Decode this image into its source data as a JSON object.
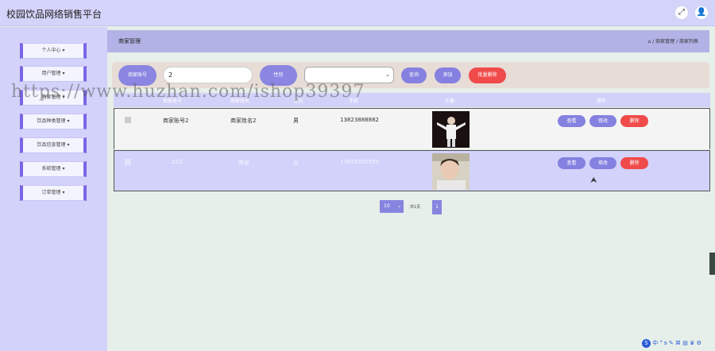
{
  "header": {
    "app_title": "校园饮品网络销售平台",
    "fullscreen_icon": "⤢",
    "user_icon": "👤"
  },
  "sidebar": {
    "items": [
      {
        "label": "个人中心 ▾"
      },
      {
        "label": "用户管理 ▾"
      },
      {
        "label": "商家管理 ▾"
      },
      {
        "label": "饮品种类管理 ▾"
      },
      {
        "label": "饮品信息管理 ▾"
      },
      {
        "label": "系统管理 ▾"
      },
      {
        "label": "订单管理 ▾"
      }
    ]
  },
  "breadcrumb": {
    "title": "商家管理",
    "path": "⌂ / 商家管理 / 商家列表"
  },
  "search": {
    "account_label": "商家账号",
    "account_value": "2",
    "gender_label": "性别",
    "gender_value": "",
    "query_button": "查询",
    "add_button": "添加",
    "batch_delete_button": "批量删除"
  },
  "table": {
    "headers": [
      "商家账号",
      "商家姓名",
      "性别",
      "手机",
      "头像",
      "操作"
    ],
    "rows": [
      {
        "account": "商家账号2",
        "name": "商家姓名2",
        "gender": "男",
        "phone": "13823888882"
      },
      {
        "account": "222",
        "name": "商家",
        "gender": "女",
        "phone": "13655555555"
      }
    ],
    "view_label": "查看",
    "edit_label": "修改",
    "delete_label": "删除"
  },
  "pagination": {
    "page_size": "10",
    "total_text": "共1页",
    "current_page": "1"
  },
  "overlay": {
    "watermark": "https://www.huzhan.com/ishop39397",
    "ime_logo": "S",
    "ime_tools": "中 ° ᵴ ✎ ⌘ ▤ ♛ ⚙"
  }
}
